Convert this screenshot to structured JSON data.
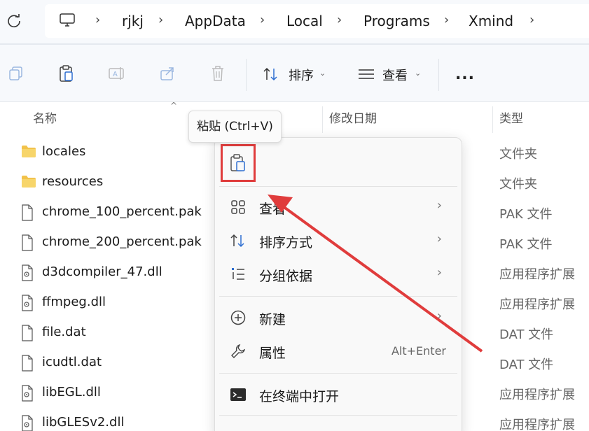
{
  "address_bar": {
    "breadcrumbs": [
      "rjkj",
      "AppData",
      "Local",
      "Programs",
      "Xmind"
    ]
  },
  "toolbar": {
    "sort_label": "排序",
    "view_label": "查看",
    "more_label": "..."
  },
  "columns": {
    "name": "名称",
    "modified": "修改日期",
    "type": "类型"
  },
  "files": [
    {
      "name": "locales",
      "type": "文件夹",
      "icon": "folder-icon"
    },
    {
      "name": "resources",
      "type": "文件夹",
      "icon": "folder-icon"
    },
    {
      "name": "chrome_100_percent.pak",
      "type": "PAK 文件",
      "icon": "file-icon"
    },
    {
      "name": "chrome_200_percent.pak",
      "type": "PAK 文件",
      "icon": "file-icon"
    },
    {
      "name": "d3dcompiler_47.dll",
      "type": "应用程序扩展",
      "icon": "dll-file-icon"
    },
    {
      "name": "ffmpeg.dll",
      "type": "应用程序扩展",
      "icon": "dll-file-icon"
    },
    {
      "name": "file.dat",
      "type": "DAT 文件",
      "icon": "file-icon"
    },
    {
      "name": "icudtl.dat",
      "type": "DAT 文件",
      "icon": "file-icon"
    },
    {
      "name": "libEGL.dll",
      "type": "应用程序扩展",
      "icon": "dll-file-icon"
    },
    {
      "name": "libGLESv2.dll",
      "type": "应用程序扩展",
      "icon": "dll-file-icon"
    }
  ],
  "tooltip": {
    "text": "粘贴 (Ctrl+V)"
  },
  "context_menu": {
    "items": [
      {
        "label": "查看",
        "has_submenu": true
      },
      {
        "label": "排序方式",
        "has_submenu": true
      },
      {
        "label": "分组依据",
        "has_submenu": true
      },
      {
        "label": "新建",
        "has_submenu": true
      },
      {
        "label": "属性",
        "shortcut": "Alt+Enter"
      },
      {
        "label": "在终端中打开"
      }
    ]
  },
  "colors": {
    "highlight_border": "#e03c3c",
    "folder": "#f2c24a",
    "accent_blue": "#2f6fd1"
  }
}
